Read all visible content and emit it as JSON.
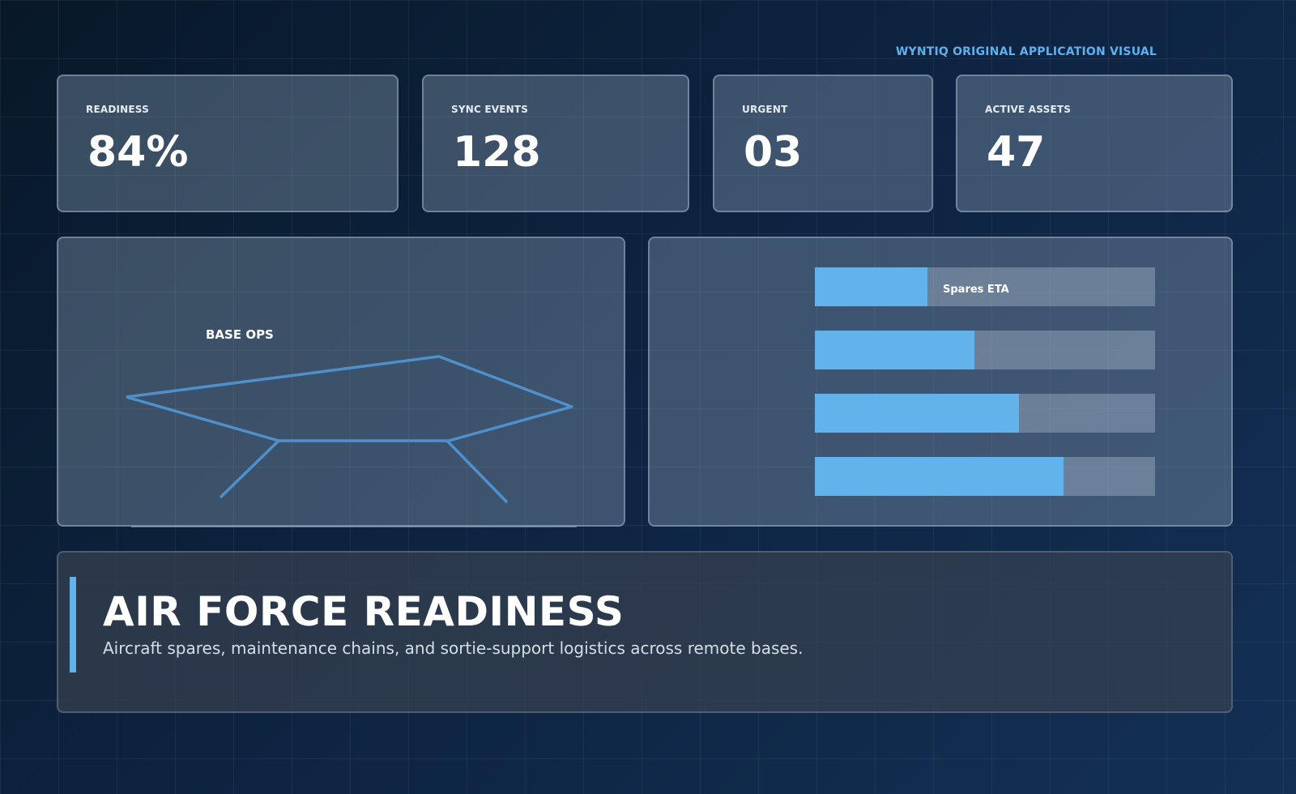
{
  "brand": "WYNTIQ ORIGINAL APPLICATION VISUAL",
  "stats": [
    {
      "label": "READINESS",
      "value": "84%"
    },
    {
      "label": "SYNC EVENTS",
      "value": "128"
    },
    {
      "label": "URGENT",
      "value": "03"
    },
    {
      "label": "ACTIVE ASSETS",
      "value": "47"
    }
  ],
  "base_ops": {
    "label": "BASE OPS"
  },
  "bars": {
    "label": "Spares ETA",
    "fractions": [
      0.33,
      0.47,
      0.6,
      0.73
    ]
  },
  "hero": {
    "title": "AIR FORCE READINESS",
    "subtitle": "Aircraft spares, maintenance chains, and sortie-support logistics across remote bases."
  },
  "colors": {
    "accent": "#62b3ec",
    "line": "#4f8fcc"
  }
}
